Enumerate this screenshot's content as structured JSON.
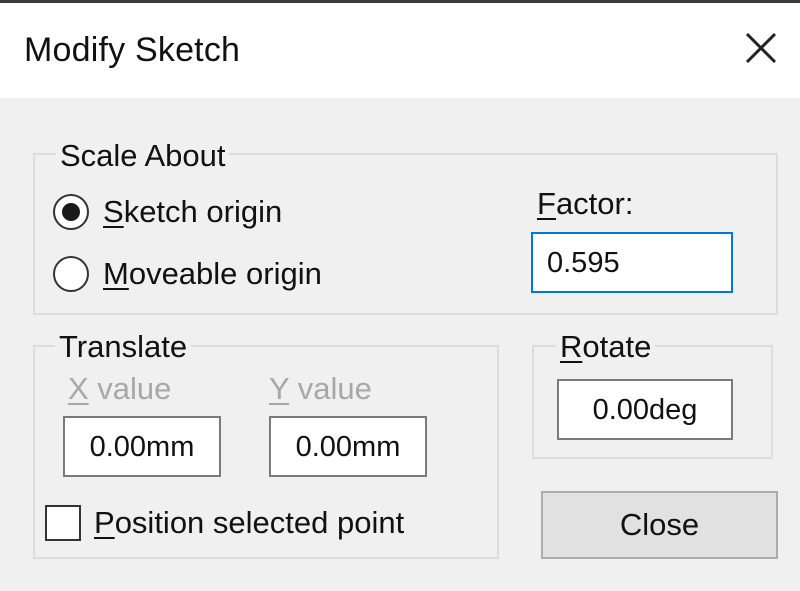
{
  "window": {
    "title": "Modify Sketch",
    "close_icon": "close-icon"
  },
  "scale_about": {
    "legend": "Scale About",
    "options": [
      {
        "label_mnemonic": "S",
        "label_rest": "ketch origin",
        "selected": true
      },
      {
        "label_mnemonic": "M",
        "label_rest": "oveable origin",
        "selected": false
      }
    ],
    "factor": {
      "label_mnemonic": "F",
      "label_rest": "actor:",
      "value": "0.595"
    }
  },
  "translate": {
    "legend": "Translate",
    "x": {
      "label_mnemonic": "X",
      "label_rest": " value",
      "value": "0.00mm"
    },
    "y": {
      "label_mnemonic": "Y",
      "label_rest": " value",
      "value": "0.00mm"
    },
    "position_selected_point": {
      "label_mnemonic": "P",
      "label_rest": "osition selected point",
      "checked": false
    }
  },
  "rotate": {
    "legend_mnemonic": "R",
    "legend_rest": "otate",
    "value": "0.00deg"
  },
  "buttons": {
    "close_label": "Close"
  }
}
